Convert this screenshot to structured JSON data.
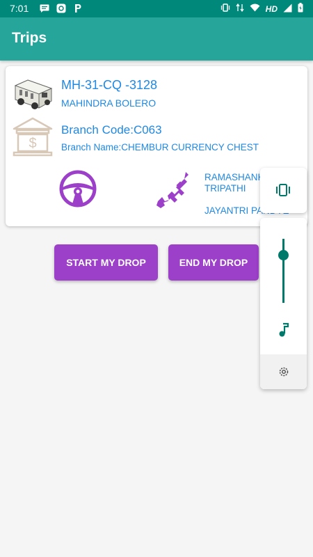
{
  "status_bar": {
    "time": "7:01",
    "left_icons": [
      "message-icon",
      "app-icon",
      "p-icon"
    ],
    "network_label": "HD",
    "right_icons": [
      "vibrate-icon",
      "data-arrows-icon",
      "wifi-icon",
      "hd-signal-icon",
      "battery-charging-icon"
    ]
  },
  "app_bar": {
    "title": "Trips"
  },
  "trip": {
    "vehicle_number": "MH-31-CQ -3128",
    "vehicle_model": "MAHINDRA BOLERO",
    "branch_code": "Branch Code:C063",
    "branch_name": "Branch Name:CHEMBUR CURRENCY CHEST",
    "guard_1": "RAMASHANKAR TRIPATHI",
    "guard_2": "JAYANTRI PANDYE",
    "icons": [
      "armored-van-icon",
      "bank-icon",
      "steering-wheel-icon",
      "rifle-icon"
    ]
  },
  "buttons": {
    "start_drop": "START MY DROP",
    "end_drop": "END MY DROP"
  },
  "volume_panel": {
    "level": 0.74,
    "icons": [
      "vibrate-icon",
      "music-note-icon",
      "settings-icon"
    ]
  },
  "colors": {
    "status_bar": "#00897b",
    "app_bar": "#26a69a",
    "accent_text": "#1e88e5",
    "button": "#9c3fc9",
    "volume_accent": "#00796b"
  }
}
